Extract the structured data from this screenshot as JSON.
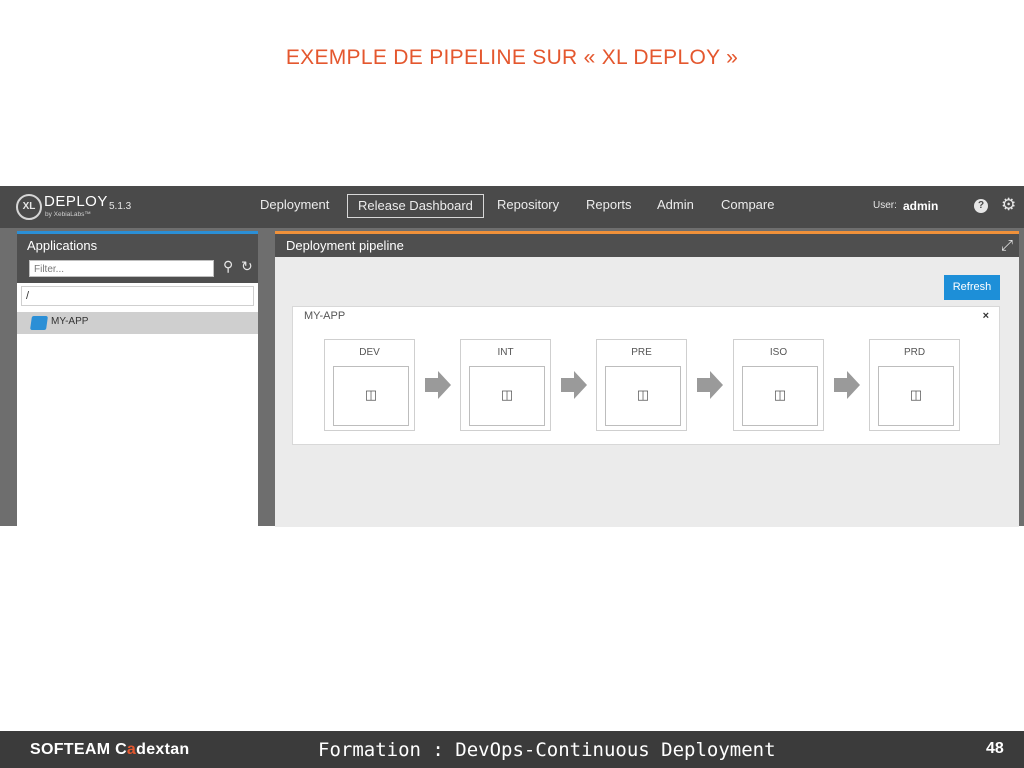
{
  "slide": {
    "title": "EXEMPLE DE PIPELINE SUR « XL DEPLOY »"
  },
  "app": {
    "logo_mark": "XL",
    "logo_name": "DEPLOY",
    "logo_sub": "by XebiaLabs™",
    "version": "5.1.3",
    "nav": [
      "Deployment",
      "Release Dashboard",
      "Repository",
      "Reports",
      "Admin",
      "Compare"
    ],
    "active_nav": "Release Dashboard",
    "user_label": "User:",
    "user_name": "admin",
    "help_glyph": "?",
    "icons": {
      "help": "help-icon",
      "settings": "gear-icon",
      "search": "search-icon",
      "refresh": "refresh-icon",
      "expand": "expand-icon",
      "app": "app-package-icon",
      "stage": "cube-icon"
    }
  },
  "left_panel": {
    "header": "Applications",
    "filter_placeholder": "Filter...",
    "path": "/",
    "tree_items": [
      "MY-APP"
    ],
    "accent": "#2b8fd6"
  },
  "right_panel": {
    "header": "Deployment pipeline",
    "refresh_label": "Refresh",
    "accent": "#f0913a",
    "pipeline": {
      "app_name": "MY-APP",
      "close_glyph": "×",
      "stages": [
        "DEV",
        "INT",
        "PRE",
        "ISO",
        "PRD"
      ]
    }
  },
  "footer": {
    "company_pre": "SOFTEAM C",
    "company_accent": "a",
    "company_post": "dextan",
    "title": "Formation : DevOps-Continuous Deployment",
    "page": "48"
  },
  "colors": {
    "title_orange": "#e4572e",
    "refresh_blue": "#1d8fd8",
    "topbar": "#4a4a4a",
    "footer": "#3b3b3b"
  }
}
